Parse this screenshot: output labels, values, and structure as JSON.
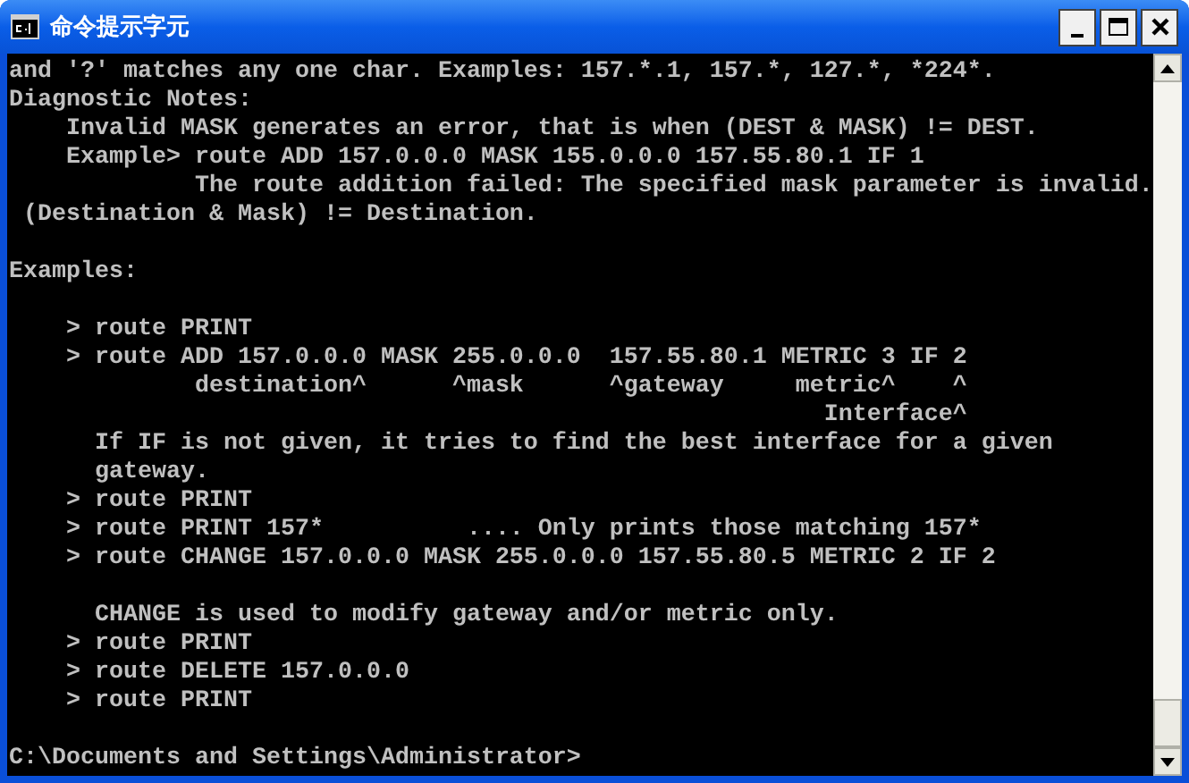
{
  "window": {
    "title": "命令提示字元"
  },
  "console": {
    "lines": [
      {
        "kind": "text",
        "text": "and '?' matches any one char. Examples: 157.*.1, 157.*, 127.*, *224*."
      },
      {
        "kind": "text",
        "text": "Diagnostic Notes:"
      },
      {
        "kind": "text",
        "text": "    Invalid MASK generates an error, that is when (DEST & MASK) != DEST."
      },
      {
        "kind": "text",
        "text": "    Example> route ADD 157.0.0.0 MASK 155.0.0.0 157.55.80.1 IF 1"
      },
      {
        "kind": "text",
        "text": "             The route addition failed: The specified mask parameter is invalid."
      },
      {
        "kind": "text",
        "text": " (Destination & Mask) != Destination."
      },
      {
        "kind": "blank"
      },
      {
        "kind": "text",
        "text": "Examples:"
      },
      {
        "kind": "blank"
      },
      {
        "kind": "text",
        "text": "    > route PRINT"
      },
      {
        "kind": "text",
        "text": "    > route ADD 157.0.0.0 MASK 255.0.0.0  157.55.80.1 METRIC 3 IF 2"
      },
      {
        "kind": "text",
        "text": "             destination^      ^mask      ^gateway     metric^    ^"
      },
      {
        "kind": "text",
        "text": "                                                         Interface^"
      },
      {
        "kind": "text",
        "text": "      If IF is not given, it tries to find the best interface for a given"
      },
      {
        "kind": "text",
        "text": "      gateway."
      },
      {
        "kind": "text",
        "text": "    > route PRINT"
      },
      {
        "kind": "text",
        "text": "    > route PRINT 157*          .... Only prints those matching 157*"
      },
      {
        "kind": "text",
        "text": "    > route CHANGE 157.0.0.0 MASK 255.0.0.0 157.55.80.5 METRIC 2 IF 2"
      },
      {
        "kind": "blank"
      },
      {
        "kind": "text",
        "text": "      CHANGE is used to modify gateway and/or metric only."
      },
      {
        "kind": "text",
        "text": "    > route PRINT"
      },
      {
        "kind": "text",
        "text": "    > route DELETE 157.0.0.0"
      },
      {
        "kind": "text",
        "text": "    > route PRINT"
      },
      {
        "kind": "blank"
      },
      {
        "kind": "prompt",
        "text": "C:\\Documents and Settings\\Administrator>"
      }
    ]
  }
}
